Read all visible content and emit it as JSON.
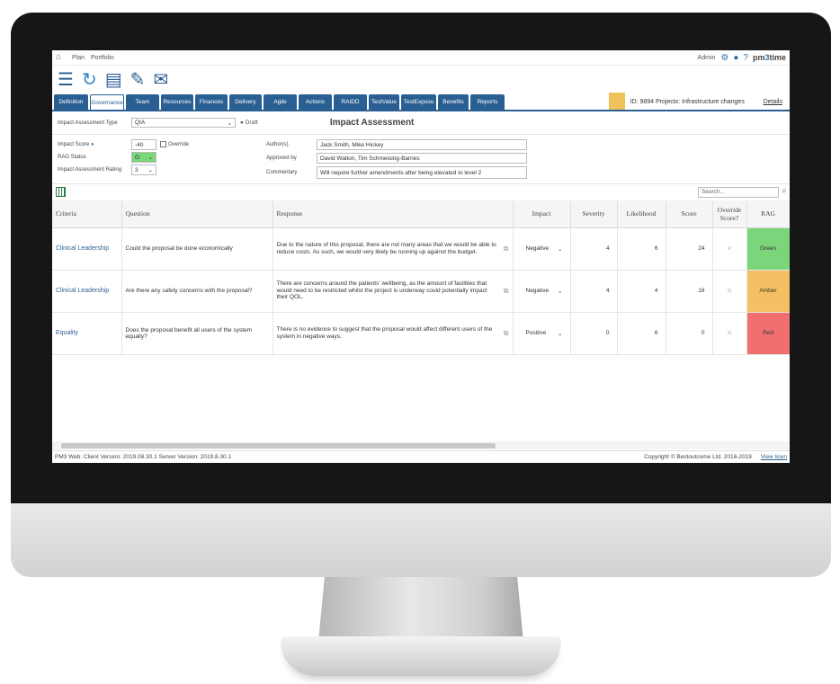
{
  "topbar": {
    "home_icon": "home-icon",
    "nav": [
      "Plan",
      "Portfolio"
    ],
    "user": "Admin",
    "logo_prefix": "pm",
    "logo_mid": "3",
    "logo_suffix": "time"
  },
  "tabs": [
    "Definition",
    "Governance",
    "Team",
    "Resources",
    "Finances",
    "Delivery",
    "Agile",
    "Actions",
    "RAIDD",
    "TestValue",
    "TestExposu",
    "Benefits",
    "Reports"
  ],
  "project": {
    "id": "ID: 9894   Projectx:  Infrastructure changes",
    "details": "Details"
  },
  "assessment": {
    "type_label": "Impact Assessment Type",
    "type_value": "QIA",
    "status": "Draft",
    "title": "Impact Assessment",
    "score_label": "Impact Score",
    "score_value": "-40",
    "override_label": "Override",
    "rag_label": "RAG Status",
    "rag_value": "G",
    "rating_label": "Impact Assessment Rating",
    "rating_value": "3",
    "authors_label": "Author(s)",
    "authors_value": "Jack Smith, Mike Hickey",
    "approved_label": "Approved by",
    "approved_value": "David Walton, Tim Schmeising-Barnes",
    "commentary_label": "Commentary",
    "commentary_value": "Will require further amendments after being elevated to level 2"
  },
  "search": {
    "placeholder": "Search..."
  },
  "table": {
    "headers": [
      "Criteria",
      "Question",
      "Response",
      "Impact",
      "Severity",
      "Likelihood",
      "Score",
      "Override Score?",
      "RAG"
    ],
    "rows": [
      {
        "criteria": "Clinical Leadership",
        "question": "Could the proposal be done economically",
        "response": "Due to the nature of this proposal, there are not many areas that we would be able to reduce costs. As such, we would very likely be running up against the budget.",
        "impact": "Negative",
        "severity": "4",
        "likelihood": "6",
        "score": "24",
        "rag": "Green",
        "rag_color": "#7bd67b"
      },
      {
        "criteria": "Clinical Leadership",
        "question": "Are there any safety concerns with the proposal?",
        "response": "There are concerns around the patients' wellbeing, as the amount of facilities that would need to be restricted whilst the project is underway could potentially impact their QOL.",
        "impact": "Negative",
        "severity": "4",
        "likelihood": "4",
        "score": "16",
        "rag": "Amber",
        "rag_color": "#f5c063"
      },
      {
        "criteria": "Equality",
        "question": "Does the proposal benefit all users of the system equally?",
        "response": "There is no evidence to suggest that the proposal would affect different users of the system in negative ways.",
        "impact": "Positive",
        "severity": "0",
        "likelihood": "6",
        "score": "0",
        "rag": "Red",
        "rag_color": "#f07070"
      }
    ]
  },
  "footer": {
    "version": "PM3 Web: Client Version: 2019.08.30.1 Server Version: 2019.8.30.1",
    "copyright": "Copyright © Bestoutcome Ltd. 2016-2019",
    "licence": "View licen"
  }
}
